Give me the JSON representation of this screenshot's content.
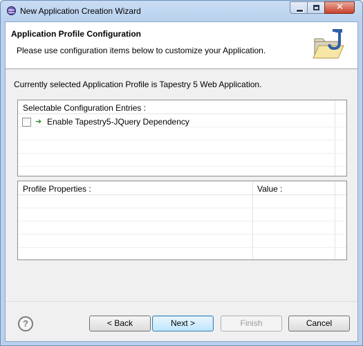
{
  "window": {
    "title": "New Application Creation Wizard",
    "controls": [
      "minimize-icon",
      "maximize-icon",
      "close-icon"
    ]
  },
  "header": {
    "title": "Application Profile Configuration",
    "description": "Please use configuration items below to customize your Application.",
    "icon": "folder-java-icon"
  },
  "profile_text": "Currently selected Application Profile is Tapestry 5 Web Application.",
  "config_table": {
    "header": "Selectable Configuration Entries :",
    "entries": [
      {
        "checked": false,
        "icon": "dependency-arrow-icon",
        "label": "Enable Tapestry5-JQuery Dependency"
      }
    ]
  },
  "properties_table": {
    "columns": [
      "Profile Properties :",
      "Value :"
    ],
    "rows": []
  },
  "buttons": {
    "back": "< Back",
    "next": "Next >",
    "finish": "Finish",
    "cancel": "Cancel",
    "help": "?"
  },
  "colors": {
    "titlebar": "#b9d1ee",
    "close_button": "#c8412c",
    "default_button": "#bee6fd"
  }
}
